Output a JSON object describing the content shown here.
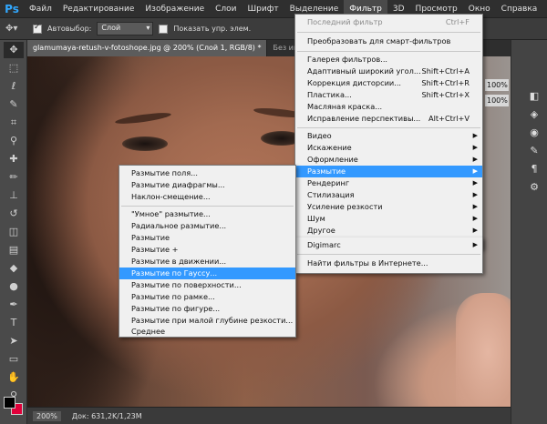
{
  "app": {
    "logo": "Ps"
  },
  "menubar": {
    "items": [
      {
        "label": "Файл"
      },
      {
        "label": "Редактирование"
      },
      {
        "label": "Изображение"
      },
      {
        "label": "Слои"
      },
      {
        "label": "Шрифт"
      },
      {
        "label": "Выделение"
      },
      {
        "label": "Фильтр"
      },
      {
        "label": "3D"
      },
      {
        "label": "Просмотр"
      },
      {
        "label": "Окно"
      },
      {
        "label": "Справка"
      }
    ]
  },
  "options": {
    "autoselect_label": "Автовыбор:",
    "autoselect_checked": true,
    "layer_select": "Слой",
    "show_controls_label": "Показать упр. элем."
  },
  "tabs": [
    {
      "label": "glamumaya-retush-v-fotoshope.jpg @ 200% (Слой 1, RGB/8) *"
    },
    {
      "label": "Без имени-"
    }
  ],
  "status": {
    "zoom": "200%",
    "doc": "Док: 631,2K/1,23M"
  },
  "right": {
    "opacity": "100%",
    "fill": "100%"
  },
  "filter_menu": {
    "items": [
      {
        "label": "Последний фильтр",
        "shortcut": "Ctrl+F",
        "disabled": true
      },
      {
        "label": "Преобразовать для смарт-фильтров"
      },
      {
        "label": "Галерея фильтров..."
      },
      {
        "label": "Адаптивный широкий угол...",
        "shortcut": "Shift+Ctrl+A"
      },
      {
        "label": "Коррекция дисторсии...",
        "shortcut": "Shift+Ctrl+R"
      },
      {
        "label": "Пластика...",
        "shortcut": "Shift+Ctrl+X"
      },
      {
        "label": "Масляная краска..."
      },
      {
        "label": "Исправление перспективы...",
        "shortcut": "Alt+Ctrl+V"
      },
      {
        "label": "Видео"
      },
      {
        "label": "Искажение"
      },
      {
        "label": "Оформление"
      },
      {
        "label": "Размытие"
      },
      {
        "label": "Рендеринг"
      },
      {
        "label": "Стилизация"
      },
      {
        "label": "Усиление резкости"
      },
      {
        "label": "Шум"
      },
      {
        "label": "Другое"
      },
      {
        "label": "Digimarc"
      },
      {
        "label": "Найти фильтры в Интернете..."
      }
    ]
  },
  "blur_menu": {
    "items": [
      {
        "label": "Размытие поля..."
      },
      {
        "label": "Размытие диафрагмы..."
      },
      {
        "label": "Наклон-смещение..."
      },
      {
        "label": "\"Умное\" размытие..."
      },
      {
        "label": "Радиальное размытие..."
      },
      {
        "label": "Размытие"
      },
      {
        "label": "Размытие +"
      },
      {
        "label": "Размытие в движении..."
      },
      {
        "label": "Размытие по Гауссу..."
      },
      {
        "label": "Размытие по поверхности..."
      },
      {
        "label": "Размытие по рамке..."
      },
      {
        "label": "Размытие по фигуре..."
      },
      {
        "label": "Размытие при малой глубине резкости..."
      },
      {
        "label": "Среднее"
      }
    ]
  }
}
